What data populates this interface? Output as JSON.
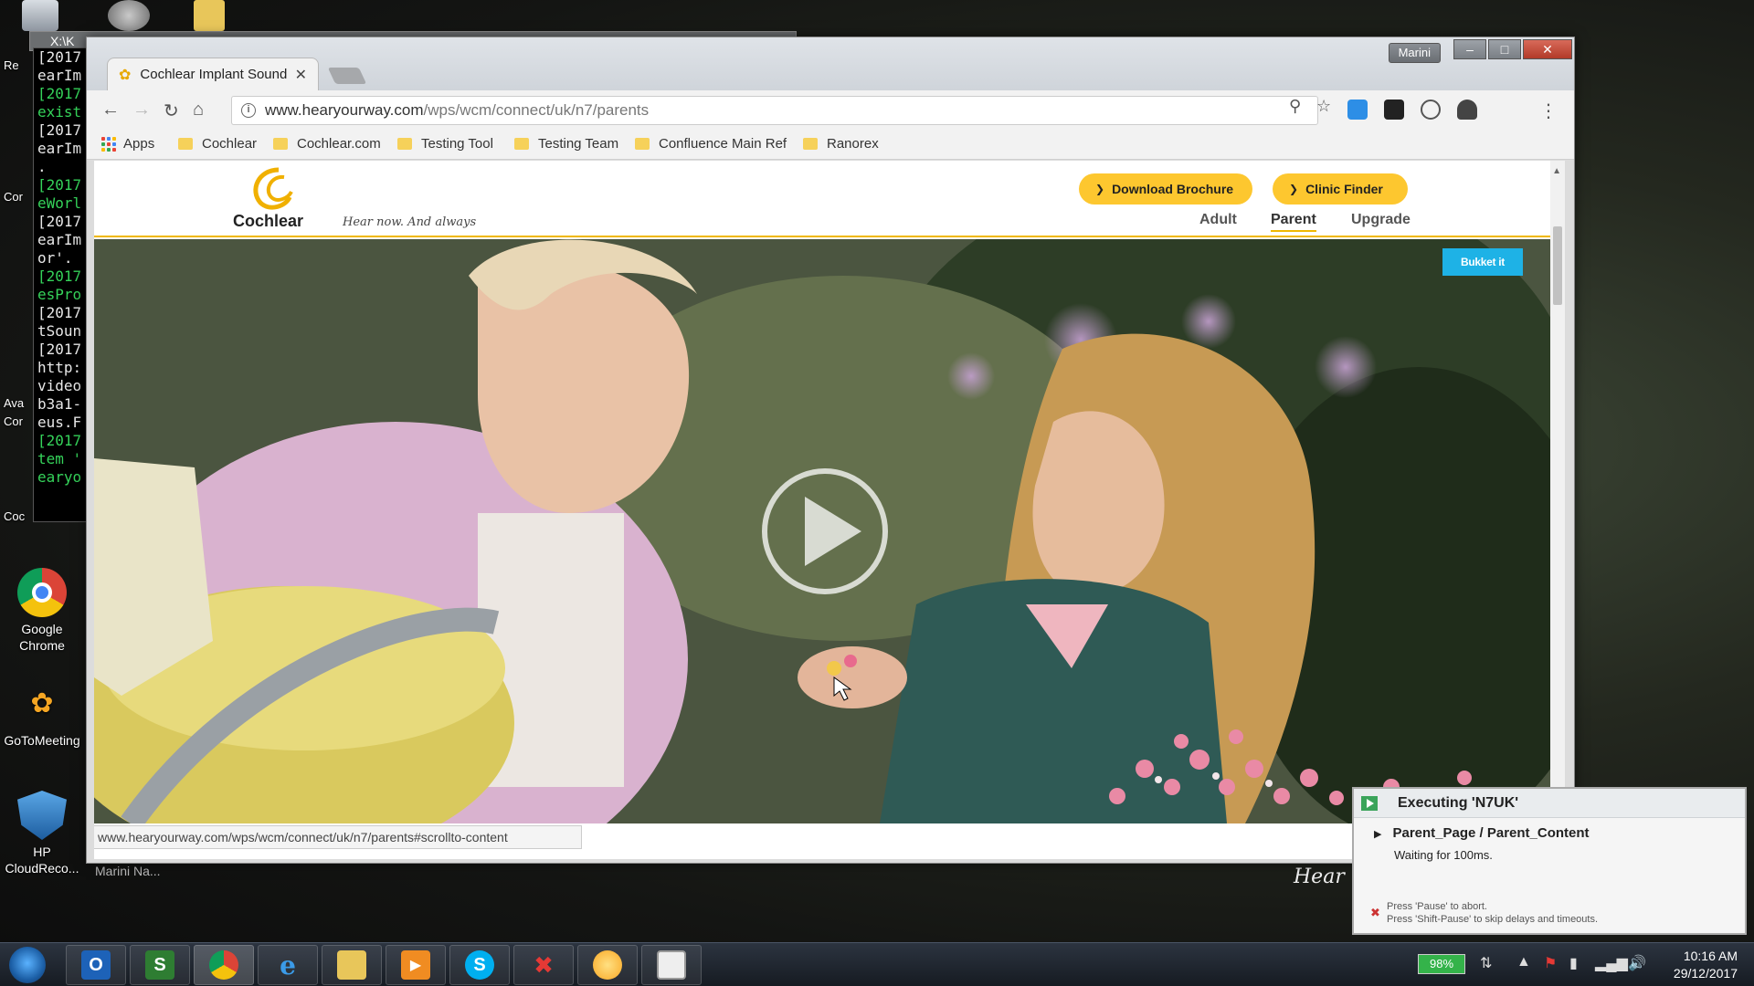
{
  "desktop": {
    "console_title": "X:\\K",
    "console_lines": [
      {
        "text": "[2017",
        "c": "w"
      },
      {
        "text": "earIm",
        "c": "w"
      },
      {
        "text": "[2017",
        "c": "g"
      },
      {
        "text": "exist",
        "c": "g"
      },
      {
        "text": "[2017",
        "c": "w"
      },
      {
        "text": "earIm",
        "c": "w"
      },
      {
        "text": ".",
        "c": "w"
      },
      {
        "text": "[2017",
        "c": "g"
      },
      {
        "text": "eWorl",
        "c": "g"
      },
      {
        "text": "[2017",
        "c": "w"
      },
      {
        "text": "earIm",
        "c": "w"
      },
      {
        "text": "or'.",
        "c": "w"
      },
      {
        "text": "[2017",
        "c": "g"
      },
      {
        "text": "esPro",
        "c": "g"
      },
      {
        "text": "[2017",
        "c": "w"
      },
      {
        "text": "tSoun",
        "c": "w"
      },
      {
        "text": "[2017",
        "c": "w"
      },
      {
        "text": "http:",
        "c": "w"
      },
      {
        "text": "video",
        "c": "w"
      },
      {
        "text": "b3a1-",
        "c": "w"
      },
      {
        "text": "eus.F",
        "c": "w"
      },
      {
        "text": "[2017",
        "c": "g"
      },
      {
        "text": "tem '",
        "c": "g"
      },
      {
        "text": "earyo",
        "c": "g"
      }
    ],
    "stubs": [
      "Re",
      "Cor",
      "Ava",
      "Cor",
      "Coc"
    ],
    "icons": [
      {
        "label": "Google Chrome",
        "name": "google-chrome-desktop-icon"
      },
      {
        "label": "GoToMeeting",
        "name": "gotomeeting-desktop-icon"
      },
      {
        "label": "HP CloudReco...",
        "name": "hp-cloud-recovery-desktop-icon"
      }
    ],
    "behind_caption": "Marini Na...",
    "behind_hero_text": "Hear n"
  },
  "browser": {
    "tab_title": "Cochlear Implant Sound",
    "user": "Marini",
    "url_host": "www.hearyourway.com",
    "url_path": "/wps/wcm/connect/uk/n7/parents",
    "bookmarks": [
      "Apps",
      "Cochlear",
      "Cochlear.com",
      "Testing Tool",
      "Testing Team",
      "Confluence Main Ref",
      "Ranorex"
    ],
    "status_url": "www.hearyourway.com/wps/wcm/connect/uk/n7/parents#scrollto-content"
  },
  "site": {
    "logo_text": "Cochlear",
    "tagline": "Hear now. And always",
    "download_brochure": "Download Brochure",
    "clinic_finder": "Clinic Finder",
    "nav": [
      "Adult",
      "Parent",
      "Upgrade"
    ],
    "active_nav": "Parent",
    "bukket": "Bukket it"
  },
  "popup": {
    "title": "Executing 'N7UK'",
    "item": "Parent_Page / Parent_Content",
    "status": "Waiting for 100ms.",
    "hint1": "Press 'Pause' to abort.",
    "hint2": "Press 'Shift-Pause' to skip delays and timeouts."
  },
  "taskbar": {
    "battery": "98%",
    "time": "10:16 AM",
    "date": "29/12/2017"
  },
  "colors": {
    "brand_yellow": "#fdc72f",
    "accent_blue": "#1eb2e6",
    "console_green": "#35d35a"
  }
}
